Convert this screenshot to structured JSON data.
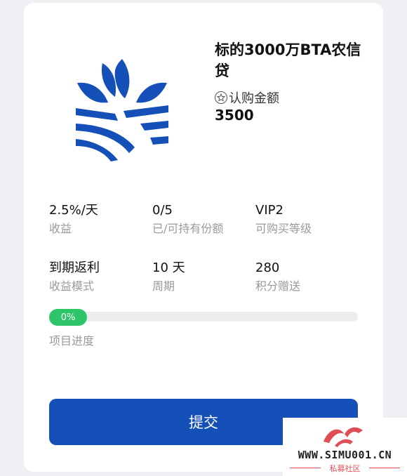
{
  "product": {
    "title": "标的3000万BTA农信贷",
    "subscribe_label": "认购金额",
    "subscribe_amount": "3500"
  },
  "stats": [
    {
      "value": "2.5%/天",
      "label": "收益"
    },
    {
      "value": "0/5",
      "label": "已/可持有份额"
    },
    {
      "value": "VIP2",
      "label": "可购买等级"
    },
    {
      "value": "到期返利",
      "label": "收益模式"
    },
    {
      "value": "10 天",
      "label": "周期"
    },
    {
      "value": "280",
      "label": "积分赠送"
    }
  ],
  "progress": {
    "value_text": "0%",
    "fraction": 0,
    "label": "项目进度"
  },
  "submit_label": "提交",
  "watermark": {
    "site": "WWW.SIMU001.CN",
    "sub": "私募社区"
  },
  "colors": {
    "brand_blue": "#1550b8",
    "progress_green": "#2ec46a",
    "watermark_red": "#e04d55"
  },
  "icons": {
    "logo": "wheat-leaf-logo-icon",
    "subscribe": "star-circle-icon"
  }
}
